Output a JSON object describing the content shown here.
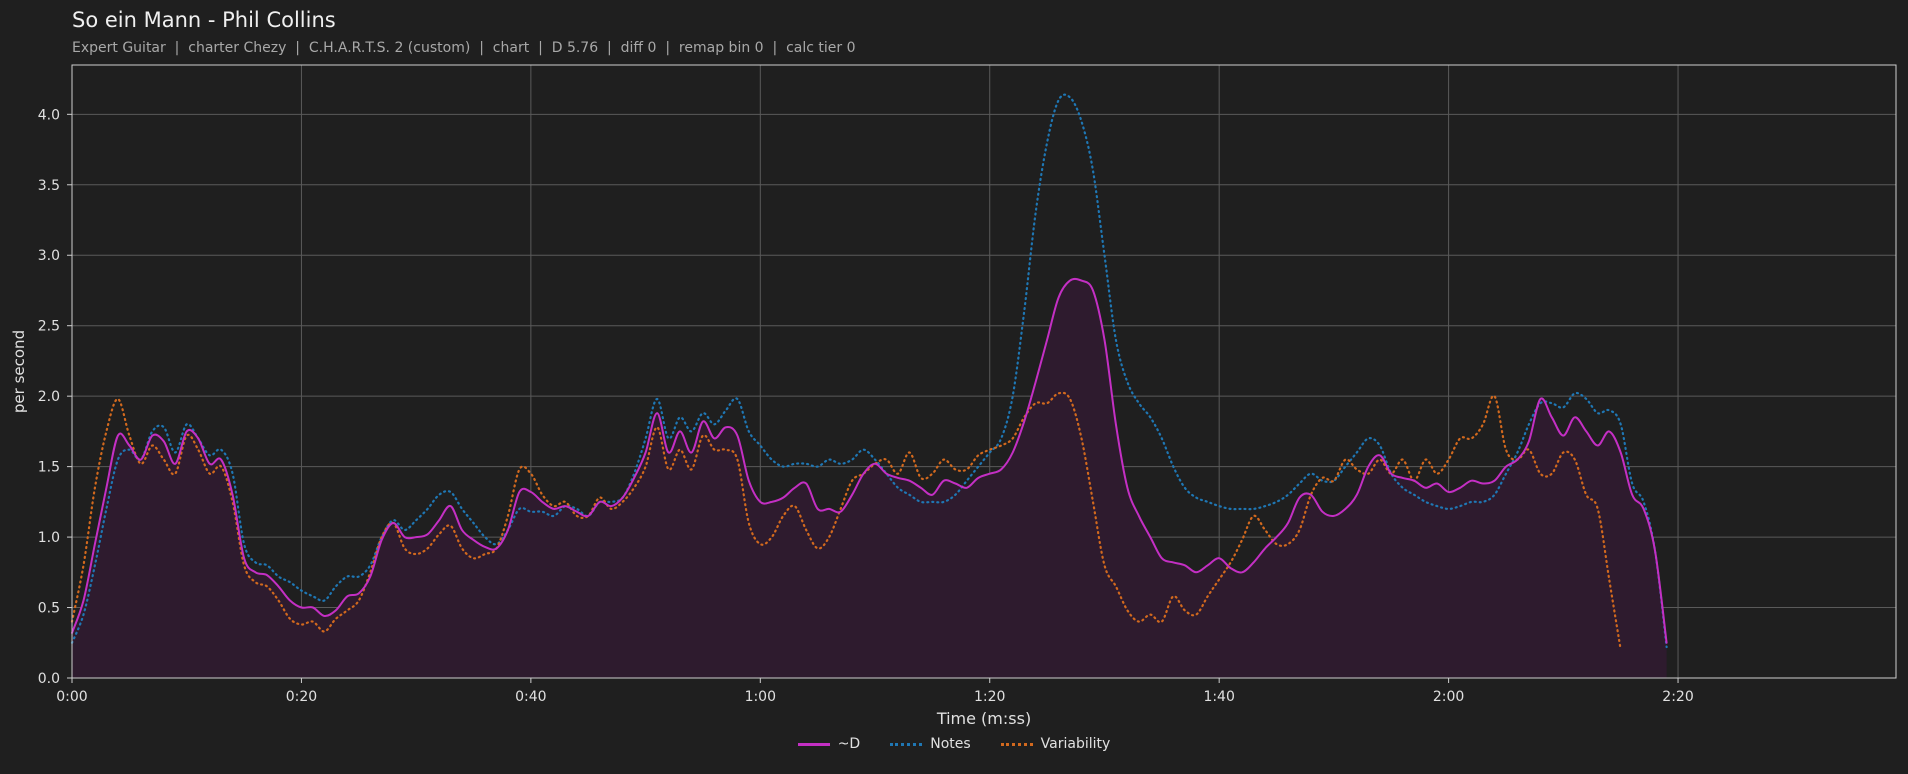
{
  "title": "So ein Mann - Phil Collins",
  "subtitle": "Expert Guitar  |  charter Chezy  |  C.H.A.R.T.S. 2 (custom)  |  chart  |  D 5.76  |  diff 0  |  remap bin 0  |  calc tier 0",
  "colors": {
    "background": "#1f1f1f",
    "d": "#c42fc4",
    "notes": "#1f77b4",
    "variability": "#d2691e",
    "fill": "#2e1b2e",
    "grid": "#5a5a5a"
  },
  "chart_data": {
    "type": "line",
    "xlabel": "Time (m:ss)",
    "ylabel": "per second",
    "xlim": [
      0,
      159
    ],
    "ylim": [
      0,
      4.35
    ],
    "grid": true,
    "legend_position": "bottom-center",
    "xticks": [
      0,
      20,
      40,
      60,
      80,
      100,
      120,
      140
    ],
    "xtick_labels": [
      "0:00",
      "0:20",
      "0:40",
      "1:00",
      "1:20",
      "1:40",
      "2:00",
      "2:20"
    ],
    "yticks": [
      0,
      0.5,
      1.0,
      1.5,
      2.0,
      2.5,
      3.0,
      3.5,
      4.0
    ],
    "ytick_labels": [
      "0.0",
      "0.5",
      "1.0",
      "1.5",
      "2.0",
      "2.5",
      "3.0",
      "3.5",
      "4.0"
    ],
    "x": [
      0,
      1,
      2,
      3,
      4,
      5,
      6,
      7,
      8,
      9,
      10,
      11,
      12,
      13,
      14,
      15,
      16,
      17,
      18,
      19,
      20,
      21,
      22,
      23,
      24,
      25,
      26,
      27,
      28,
      29,
      30,
      31,
      32,
      33,
      34,
      35,
      36,
      37,
      38,
      39,
      40,
      41,
      42,
      43,
      44,
      45,
      46,
      47,
      48,
      49,
      50,
      51,
      52,
      53,
      54,
      55,
      56,
      57,
      58,
      59,
      60,
      61,
      62,
      63,
      64,
      65,
      66,
      67,
      68,
      69,
      70,
      71,
      72,
      73,
      74,
      75,
      76,
      77,
      78,
      79,
      80,
      81,
      82,
      83,
      84,
      85,
      86,
      87,
      88,
      89,
      90,
      91,
      92,
      93,
      94,
      95,
      96,
      97,
      98,
      99,
      100,
      101,
      102,
      103,
      104,
      105,
      106,
      107,
      108,
      109,
      110,
      111,
      112,
      113,
      114,
      115,
      116,
      117,
      118,
      119,
      120,
      121,
      122,
      123,
      124,
      125,
      126,
      127,
      128,
      129,
      130,
      131,
      132,
      133,
      134,
      135,
      136,
      137,
      138,
      139,
      140,
      141,
      142,
      143,
      144,
      145,
      146,
      147,
      148,
      149,
      150,
      151,
      152,
      153,
      154,
      155,
      156,
      157,
      158,
      159
    ],
    "series": [
      {
        "name": "~D",
        "style": "solid",
        "color": "#c42fc4",
        "values": [
          0.32,
          0.55,
          0.95,
          1.35,
          1.72,
          1.65,
          1.55,
          1.72,
          1.68,
          1.52,
          1.75,
          1.7,
          1.52,
          1.55,
          1.3,
          0.85,
          0.75,
          0.73,
          0.65,
          0.55,
          0.5,
          0.5,
          0.44,
          0.48,
          0.58,
          0.6,
          0.72,
          0.98,
          1.1,
          1.0,
          1.0,
          1.02,
          1.12,
          1.22,
          1.05,
          0.98,
          0.93,
          0.92,
          1.05,
          1.32,
          1.32,
          1.25,
          1.2,
          1.22,
          1.18,
          1.15,
          1.25,
          1.22,
          1.28,
          1.42,
          1.6,
          1.88,
          1.6,
          1.75,
          1.6,
          1.82,
          1.7,
          1.78,
          1.72,
          1.4,
          1.25,
          1.25,
          1.28,
          1.35,
          1.38,
          1.2,
          1.2,
          1.18,
          1.3,
          1.45,
          1.52,
          1.45,
          1.42,
          1.4,
          1.35,
          1.3,
          1.4,
          1.38,
          1.35,
          1.42,
          1.45,
          1.48,
          1.6,
          1.82,
          2.1,
          2.4,
          2.7,
          2.82,
          2.82,
          2.75,
          2.4,
          1.8,
          1.35,
          1.15,
          1.0,
          0.85,
          0.82,
          0.8,
          0.75,
          0.8,
          0.85,
          0.78,
          0.75,
          0.82,
          0.92,
          1.0,
          1.1,
          1.28,
          1.3,
          1.18,
          1.15,
          1.2,
          1.3,
          1.5,
          1.58,
          1.45,
          1.42,
          1.4,
          1.35,
          1.38,
          1.32,
          1.35,
          1.4,
          1.38,
          1.4,
          1.5,
          1.55,
          1.68,
          1.98,
          1.85,
          1.72,
          1.85,
          1.75,
          1.65,
          1.75,
          1.6,
          1.3,
          1.2,
          0.9,
          0.25
        ]
      },
      {
        "name": "Notes",
        "style": "dotted",
        "color": "#1f77b4",
        "values": [
          0.25,
          0.45,
          0.8,
          1.2,
          1.55,
          1.62,
          1.55,
          1.75,
          1.78,
          1.6,
          1.8,
          1.7,
          1.58,
          1.62,
          1.45,
          0.95,
          0.82,
          0.8,
          0.72,
          0.68,
          0.62,
          0.58,
          0.55,
          0.65,
          0.72,
          0.72,
          0.8,
          1.0,
          1.12,
          1.05,
          1.12,
          1.2,
          1.3,
          1.32,
          1.2,
          1.1,
          1.0,
          0.95,
          1.05,
          1.2,
          1.18,
          1.18,
          1.15,
          1.22,
          1.2,
          1.15,
          1.25,
          1.25,
          1.28,
          1.45,
          1.7,
          1.98,
          1.7,
          1.85,
          1.75,
          1.88,
          1.8,
          1.9,
          1.98,
          1.75,
          1.65,
          1.55,
          1.5,
          1.52,
          1.52,
          1.5,
          1.55,
          1.52,
          1.55,
          1.62,
          1.55,
          1.45,
          1.35,
          1.3,
          1.25,
          1.25,
          1.25,
          1.3,
          1.4,
          1.5,
          1.6,
          1.7,
          2.0,
          2.6,
          3.3,
          3.8,
          4.1,
          4.12,
          3.95,
          3.6,
          3.0,
          2.4,
          2.1,
          1.95,
          1.85,
          1.7,
          1.5,
          1.35,
          1.28,
          1.25,
          1.22,
          1.2,
          1.2,
          1.2,
          1.22,
          1.25,
          1.3,
          1.38,
          1.45,
          1.4,
          1.4,
          1.5,
          1.6,
          1.7,
          1.65,
          1.45,
          1.35,
          1.3,
          1.25,
          1.22,
          1.2,
          1.22,
          1.25,
          1.25,
          1.3,
          1.45,
          1.6,
          1.8,
          1.95,
          1.95,
          1.92,
          2.02,
          1.98,
          1.88,
          1.9,
          1.8,
          1.38,
          1.25,
          0.9,
          0.22
        ]
      },
      {
        "name": "Variability",
        "style": "dotted",
        "color": "#d2691e",
        "values": [
          0.4,
          0.8,
          1.35,
          1.75,
          1.98,
          1.72,
          1.52,
          1.65,
          1.55,
          1.45,
          1.72,
          1.62,
          1.45,
          1.5,
          1.25,
          0.8,
          0.68,
          0.65,
          0.55,
          0.42,
          0.38,
          0.4,
          0.33,
          0.42,
          0.48,
          0.55,
          0.75,
          1.0,
          1.1,
          0.92,
          0.88,
          0.92,
          1.02,
          1.08,
          0.92,
          0.85,
          0.88,
          0.92,
          1.15,
          1.48,
          1.45,
          1.3,
          1.22,
          1.25,
          1.15,
          1.15,
          1.28,
          1.2,
          1.25,
          1.35,
          1.5,
          1.78,
          1.48,
          1.62,
          1.48,
          1.72,
          1.62,
          1.62,
          1.55,
          1.1,
          0.95,
          1.0,
          1.15,
          1.22,
          1.05,
          0.92,
          1.0,
          1.2,
          1.4,
          1.45,
          1.52,
          1.55,
          1.45,
          1.6,
          1.42,
          1.45,
          1.55,
          1.48,
          1.48,
          1.58,
          1.62,
          1.65,
          1.7,
          1.85,
          1.95,
          1.95,
          2.02,
          1.98,
          1.7,
          1.25,
          0.8,
          0.65,
          0.48,
          0.4,
          0.45,
          0.4,
          0.58,
          0.48,
          0.45,
          0.58,
          0.7,
          0.82,
          0.98,
          1.15,
          1.05,
          0.95,
          0.95,
          1.05,
          1.3,
          1.42,
          1.4,
          1.55,
          1.48,
          1.45,
          1.55,
          1.45,
          1.55,
          1.4,
          1.55,
          1.45,
          1.55,
          1.7,
          1.7,
          1.8,
          2.0,
          1.62,
          1.55,
          1.62,
          1.45,
          1.45,
          1.6,
          1.55,
          1.3,
          1.2,
          0.7,
          0.2
        ]
      }
    ]
  }
}
